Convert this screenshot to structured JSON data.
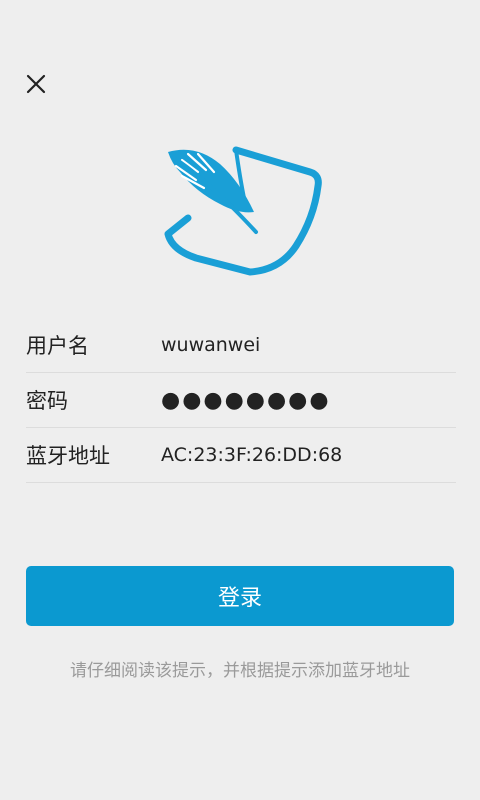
{
  "header": {
    "close_icon": "close-icon"
  },
  "logo": {
    "icon": "feather-paper-logo",
    "color": "#1a9fd6"
  },
  "form": {
    "username": {
      "label": "用户名",
      "value": "wuwanwei"
    },
    "password": {
      "label": "密码",
      "value": "●●●●●●●●"
    },
    "bluetooth": {
      "label": "蓝牙地址",
      "value": "AC:23:3F:26:DD:68"
    }
  },
  "login_button": {
    "label": "登录",
    "color": "#0b99d0"
  },
  "hint": {
    "text": "请仔细阅读该提示，并根据提示添加蓝牙地址"
  }
}
